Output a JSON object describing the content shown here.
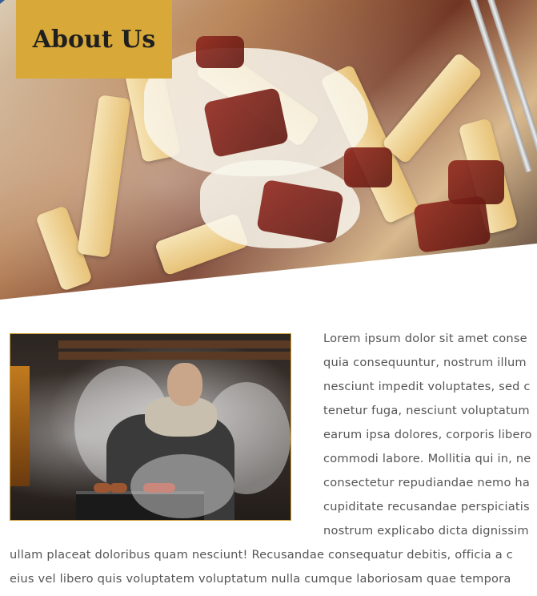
{
  "header": {
    "title": "About Us"
  },
  "content": {
    "lines_wrapped": [
      "Lorem ipsum dolor sit amet conse",
      "quia consequuntur, nostrum illum",
      "nesciunt impedit voluptates, sed c",
      "tenetur fuga, nesciunt voluptatum",
      "earum ipsa dolores, corporis libero",
      "commodi labore. Mollitia qui in, ne",
      "consectetur repudiandae nemo ha",
      "cupiditate recusandae perspiciatis",
      "nostrum explicabo dicta dignissim"
    ],
    "lines_full": [
      "ullam placeat doloribus quam nesciunt! Recusandae consequatur debitis, officia a c",
      "eius vel libero quis voluptatem voluptatum nulla cumque laboriosam quae tempora"
    ]
  },
  "colors": {
    "accent": "#d8a838",
    "frame_border": "#c99a2e",
    "text": "#555555"
  }
}
